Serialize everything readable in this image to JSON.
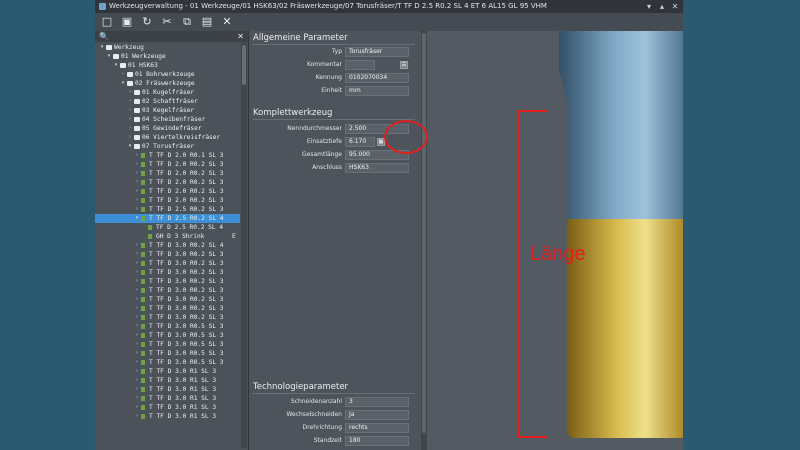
{
  "window": {
    "title": "Werkzeugverwaltung - 01 Werkzeuge/01 HSK63/02 Fräswerkzeuge/07 Torusfräser/T TF D 2.5 R0.2  SL 4  ET 6  AL15 GL 95 VHM",
    "controls": [
      "▾",
      "▴",
      "✕"
    ]
  },
  "toolbar": {
    "items": [
      {
        "name": "new-document-icon",
        "glyph": "□"
      },
      {
        "name": "save-icon",
        "glyph": "▣"
      },
      {
        "name": "refresh-icon",
        "glyph": "↻"
      },
      {
        "name": "cut-icon",
        "glyph": "✂"
      },
      {
        "name": "copy-icon",
        "glyph": "⧉"
      },
      {
        "name": "paste-icon",
        "glyph": "▤"
      },
      {
        "name": "delete-icon",
        "glyph": "✕"
      }
    ]
  },
  "search": {
    "icon": "🔍",
    "close": "✕"
  },
  "tree": [
    {
      "label": "Werkzeug",
      "level": 0,
      "icon": "folder",
      "chev": "▾"
    },
    {
      "label": "01 Werkzeuge",
      "level": 1,
      "icon": "folder",
      "chev": "▾"
    },
    {
      "label": "01 HSK63",
      "level": 2,
      "icon": "folder",
      "chev": "▾"
    },
    {
      "label": "01 Bohrwerkzeuge",
      "level": 3,
      "icon": "folder",
      "chev": "›"
    },
    {
      "label": "02 Fräswerkzeuge",
      "level": 3,
      "icon": "folder",
      "chev": "▾"
    },
    {
      "label": "01 Kugelfräser",
      "level": 4,
      "icon": "folder",
      "chev": "›"
    },
    {
      "label": "02 Schaftfräser",
      "level": 4,
      "icon": "folder",
      "chev": "›"
    },
    {
      "label": "03 Kegelfräser",
      "level": 4,
      "icon": "folder",
      "chev": "›"
    },
    {
      "label": "04 Scheibenfräser",
      "level": 4,
      "icon": "folder",
      "chev": "›"
    },
    {
      "label": "05 Gewindefräser",
      "level": 4,
      "icon": "folder",
      "chev": "›"
    },
    {
      "label": "06 Viertelkreisfräser",
      "level": 4,
      "icon": "folder",
      "chev": "›"
    },
    {
      "label": "07 Torusfräser",
      "level": 4,
      "icon": "folder",
      "chev": "▾"
    },
    {
      "label": "T TF D 2.0 R0.1  SL 3",
      "level": 5,
      "icon": "tool",
      "chev": "›"
    },
    {
      "label": "T TF D 2.0 R0.2  SL 3",
      "level": 5,
      "icon": "tool",
      "chev": "›"
    },
    {
      "label": "T TF D 2.0 R0.2  SL 3",
      "level": 5,
      "icon": "tool",
      "chev": "›"
    },
    {
      "label": "T TF D 2.0 R0.2  SL 3",
      "level": 5,
      "icon": "tool",
      "chev": "›"
    },
    {
      "label": "T TF D 2.0 R0.2  SL 3",
      "level": 5,
      "icon": "tool",
      "chev": "›"
    },
    {
      "label": "T TF D 2.0 R0.2  SL 3",
      "level": 5,
      "icon": "tool",
      "chev": "›"
    },
    {
      "label": "T TF D 2.5 R0.2  SL 3",
      "level": 5,
      "icon": "tool",
      "chev": "›"
    },
    {
      "label": "T TF D 2.5 R0.2  SL 4",
      "level": 5,
      "icon": "tool",
      "chev": "▾",
      "selected": true
    },
    {
      "label": "TF D 2.5 R0.2  SL 4",
      "level": 6,
      "icon": "tool",
      "chev": ""
    },
    {
      "label": "GH D 3 Shrink",
      "level": 6,
      "icon": "tool",
      "chev": "",
      "end": "E"
    },
    {
      "label": "T TF D 3.0 R0.2  SL 4",
      "level": 5,
      "icon": "tool",
      "chev": "›"
    },
    {
      "label": "T TF D 3.0 R0.2  SL 3",
      "level": 5,
      "icon": "tool",
      "chev": "›"
    },
    {
      "label": "T TF D 3.0 R0.2  SL 3",
      "level": 5,
      "icon": "tool",
      "chev": "›"
    },
    {
      "label": "T TF D 3.0 R0.2  SL 3",
      "level": 5,
      "icon": "tool",
      "chev": "›"
    },
    {
      "label": "T TF D 3.0 R0.2  SL 3",
      "level": 5,
      "icon": "tool",
      "chev": "›"
    },
    {
      "label": "T TF D 3.0 R0.2  SL 3",
      "level": 5,
      "icon": "tool",
      "chev": "›"
    },
    {
      "label": "T TF D 3.0 R0.2  SL 3",
      "level": 5,
      "icon": "tool",
      "chev": "›"
    },
    {
      "label": "T TF D 3.0 R0.2  SL 3",
      "level": 5,
      "icon": "tool",
      "chev": "›"
    },
    {
      "label": "T TF D 3.0 R0.2  SL 3",
      "level": 5,
      "icon": "tool",
      "chev": "›"
    },
    {
      "label": "T TF D 3.0 R0.5  SL 3",
      "level": 5,
      "icon": "tool",
      "chev": "›"
    },
    {
      "label": "T TF D 3.0 R0.5  SL 3",
      "level": 5,
      "icon": "tool",
      "chev": "›"
    },
    {
      "label": "T TF D 3.0 R0.5  SL 3",
      "level": 5,
      "icon": "tool",
      "chev": "›"
    },
    {
      "label": "T TF D 3.0 R0.5  SL 3",
      "level": 5,
      "icon": "tool",
      "chev": "›"
    },
    {
      "label": "T TF D 3.0 R0.5  SL 3",
      "level": 5,
      "icon": "tool",
      "chev": "›"
    },
    {
      "label": "T TF D 3.0 R1    SL 3",
      "level": 5,
      "icon": "tool",
      "chev": "›"
    },
    {
      "label": "T TF D 3.0 R1    SL 3",
      "level": 5,
      "icon": "tool",
      "chev": "›"
    },
    {
      "label": "T TF D 3.0 R1    SL 3",
      "level": 5,
      "icon": "tool",
      "chev": "›"
    },
    {
      "label": "T TF D 3.0 R1    SL 3",
      "level": 5,
      "icon": "tool",
      "chev": "›"
    },
    {
      "label": "T TF D 3.0 R1    SL 3",
      "level": 5,
      "icon": "tool",
      "chev": "›"
    },
    {
      "label": "T TF D 3.0 R1    SL 3",
      "level": 5,
      "icon": "tool",
      "chev": "›"
    }
  ],
  "general": {
    "title": "Allgemeine Parameter",
    "rows": [
      {
        "label": "Typ",
        "value": "Torusfräser"
      },
      {
        "label": "Kommentar",
        "value": "",
        "button": "☰"
      },
      {
        "label": "Kennung",
        "value": "0102070034"
      },
      {
        "label": "Einheit",
        "value": "mm"
      }
    ]
  },
  "complete": {
    "title": "Komplettwerkzeug",
    "rows": [
      {
        "label": "Nenndurchmesser",
        "value": "2.500"
      },
      {
        "label": "Einsatztiefe",
        "value": "6.170",
        "button": "▦"
      },
      {
        "label": "Gesamtlänge",
        "value": "95.000"
      },
      {
        "label": "Anschluss",
        "value": "HSK63"
      }
    ]
  },
  "tech": {
    "title": "Technologieparameter",
    "rows": [
      {
        "label": "Schneidenanzahl",
        "value": "3"
      },
      {
        "label": "Wechselschneiden",
        "value": "Ja"
      },
      {
        "label": "Drehrichtung",
        "value": "rechts"
      },
      {
        "label": "Standzeit",
        "value": "180"
      }
    ]
  },
  "viewer": {
    "annotation": "Länge",
    "colors": {
      "steel": "#5f8db0",
      "gold": "#c9a83a",
      "annotation": "#e01f1f"
    }
  }
}
